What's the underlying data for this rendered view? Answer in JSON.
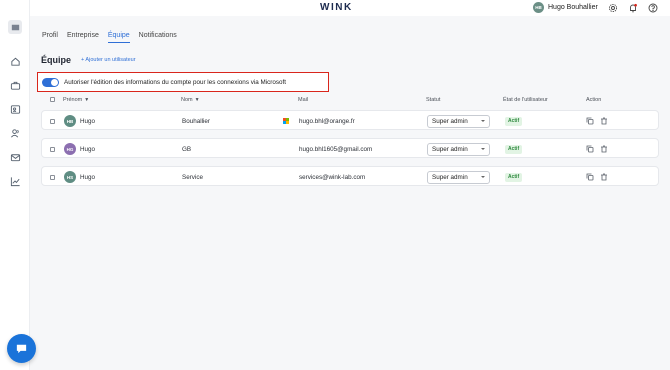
{
  "brand": "WINK",
  "user": {
    "name": "Hugo Bouhallier",
    "initials": "HB"
  },
  "tabs": [
    {
      "label": "Profil"
    },
    {
      "label": "Entreprise"
    },
    {
      "label": "Équipe"
    },
    {
      "label": "Notifications"
    }
  ],
  "section": {
    "title": "Équipe",
    "add_user": "+ Ajouter un utilisateur"
  },
  "toggle": {
    "label": "Autoriser l'édition des informations du compte pour les connexions via Microsoft",
    "enabled": true
  },
  "table": {
    "headers": {
      "firstname": "Prénom",
      "lastname": "Nom",
      "mail": "Mail",
      "status": "Statut",
      "user_state": "État de l'utilisateur",
      "action": "Action"
    },
    "rows": [
      {
        "initials": "HB",
        "avatar_color": "#5f8d83",
        "firstname": "Hugo",
        "lastname": "Bouhallier",
        "microsoft": true,
        "mail": "hugo.bhl@orange.fr",
        "status": "Super admin",
        "state": "Actif"
      },
      {
        "initials": "HG",
        "avatar_color": "#8c6fb0",
        "firstname": "Hugo",
        "lastname": "GB",
        "microsoft": false,
        "mail": "hugo.bhl1605@gmail.com",
        "status": "Super admin",
        "state": "Actif"
      },
      {
        "initials": "HS",
        "avatar_color": "#5f8d83",
        "firstname": "Hugo",
        "lastname": "Service",
        "microsoft": false,
        "mail": "services@wink-lab.com",
        "status": "Super admin",
        "state": "Actif"
      }
    ]
  },
  "colors": {
    "accent": "#2f6fd6",
    "highlight_border": "#d9261c",
    "active_badge": "#2f8a3f"
  },
  "icons": [
    "home-icon",
    "briefcase-icon",
    "user-id-icon",
    "users-icon",
    "mail-icon",
    "chart-icon",
    "gear-icon",
    "bell-icon",
    "help-icon",
    "copy-icon",
    "trash-icon",
    "chat-icon",
    "sort-down-icon"
  ]
}
